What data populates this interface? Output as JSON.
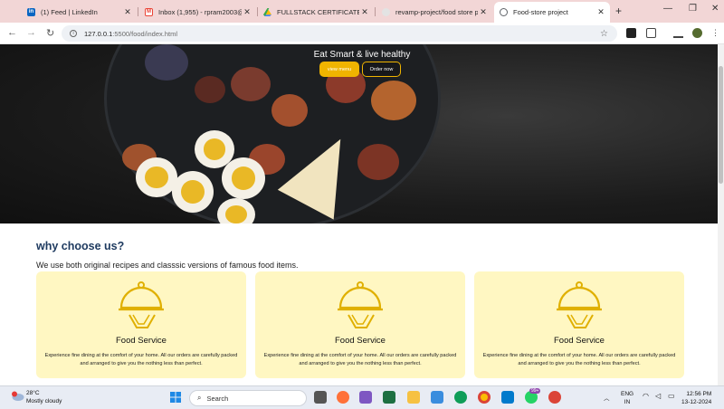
{
  "browser": {
    "tabs": [
      {
        "title": "(1) Feed | LinkedIn",
        "icon": "linkedin-icon",
        "color": "#0a66c2"
      },
      {
        "title": "Inbox (1,955) - rpram2003@",
        "icon": "gmail-icon",
        "color": "#ea4335"
      },
      {
        "title": "FULLSTACK CERTIFICATE - G",
        "icon": "drive-icon",
        "color": "#34a853"
      },
      {
        "title": "revamp-project/food store p",
        "icon": "github-icon",
        "color": "#7a7a7a"
      },
      {
        "title": "Food-store project",
        "icon": "globe-icon",
        "color": "#5f6368"
      }
    ],
    "active_tab": 4,
    "new_tab": "+",
    "url_host": "127.0.0.1",
    "url_path": ":5500/food/index.html"
  },
  "hero": {
    "tagline": "Eat Smart & live healthy",
    "view_menu_label": "view menu",
    "order_now_label": "Order now"
  },
  "features": {
    "title": "why choose us?",
    "subtitle": "We use both original recipes and classsic versions of famous food items.",
    "cards": [
      {
        "title": "Food Service",
        "desc": "Experience fine dining at the comfort of your home. All our orders are carefully packed and arranged to give you the nothing less than perfect.",
        "icon": "cloche-icon"
      },
      {
        "title": "Food Service",
        "desc": "Experience fine dining at the comfort of your home. All our orders are carefully packed and arranged to give you the nothing less than perfect.",
        "icon": "cloche-icon"
      },
      {
        "title": "Food Service",
        "desc": "Experience fine dining at the comfort of your home. All our orders are carefully packed and arranged to give you the nothing less than perfect.",
        "icon": "cloche-icon"
      }
    ],
    "accent": "#f0b400",
    "card_bg": "#fff7c2"
  },
  "taskbar": {
    "temperature": "28°C",
    "weather": "Mostly cloudy",
    "search_label": "Search",
    "notification_badge": "99+",
    "language": "ENG",
    "region": "IN",
    "time": "12:56 PM",
    "date": "13-12-2024"
  }
}
